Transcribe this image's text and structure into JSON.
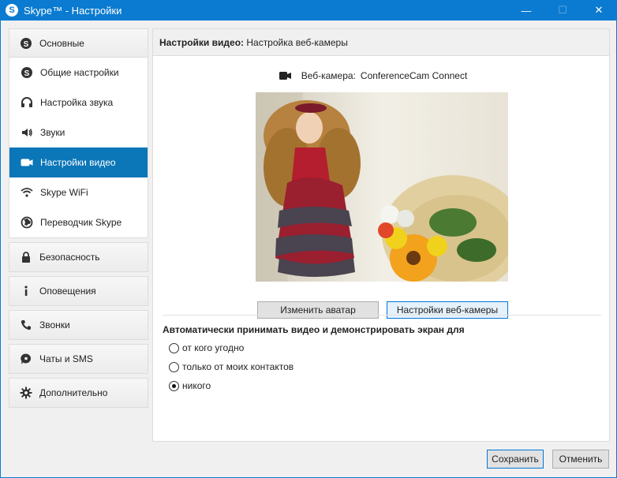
{
  "window": {
    "title": "Skype™ - Настройки",
    "logo_letter": "S",
    "minimize": "—",
    "maximize": "☐",
    "close": "✕"
  },
  "sidebar": {
    "main_group": {
      "label": "Основные",
      "icon": "skype-icon",
      "items": [
        {
          "label": "Общие настройки",
          "icon": "skype-icon"
        },
        {
          "label": "Настройка звука",
          "icon": "headset-icon"
        },
        {
          "label": "Звуки",
          "icon": "speaker-icon"
        },
        {
          "label": "Настройки видео",
          "icon": "video-camera-icon",
          "active": true
        },
        {
          "label": "Skype WiFi",
          "icon": "wifi-icon"
        },
        {
          "label": "Переводчик Skype",
          "icon": "globe-icon"
        }
      ]
    },
    "groups": [
      {
        "label": "Безопасность",
        "icon": "lock-icon"
      },
      {
        "label": "Оповещения",
        "icon": "info-icon"
      },
      {
        "label": "Звонки",
        "icon": "phone-icon"
      },
      {
        "label": "Чаты и SMS",
        "icon": "chat-icon"
      },
      {
        "label": "Дополнительно",
        "icon": "gear-icon"
      }
    ]
  },
  "main": {
    "header_bold": "Настройки видео:",
    "header_rest": " Настройка веб-камеры",
    "camera_label": "Веб-камера:",
    "camera_value": "ConferenceCam Connect",
    "change_avatar": "Изменить аватар",
    "webcam_settings": "Настройки веб-камеры",
    "auto_title": "Автоматически принимать видео и демонстрировать экран для",
    "radio_options": [
      {
        "label": "от кого угодно",
        "checked": false
      },
      {
        "label": "только от моих контактов",
        "checked": false
      },
      {
        "label": "никого",
        "checked": true
      }
    ]
  },
  "footer": {
    "save": "Сохранить",
    "cancel": "Отменить"
  },
  "colors": {
    "titlebar": "#0a7bd0",
    "active_item": "#0b76b8"
  }
}
